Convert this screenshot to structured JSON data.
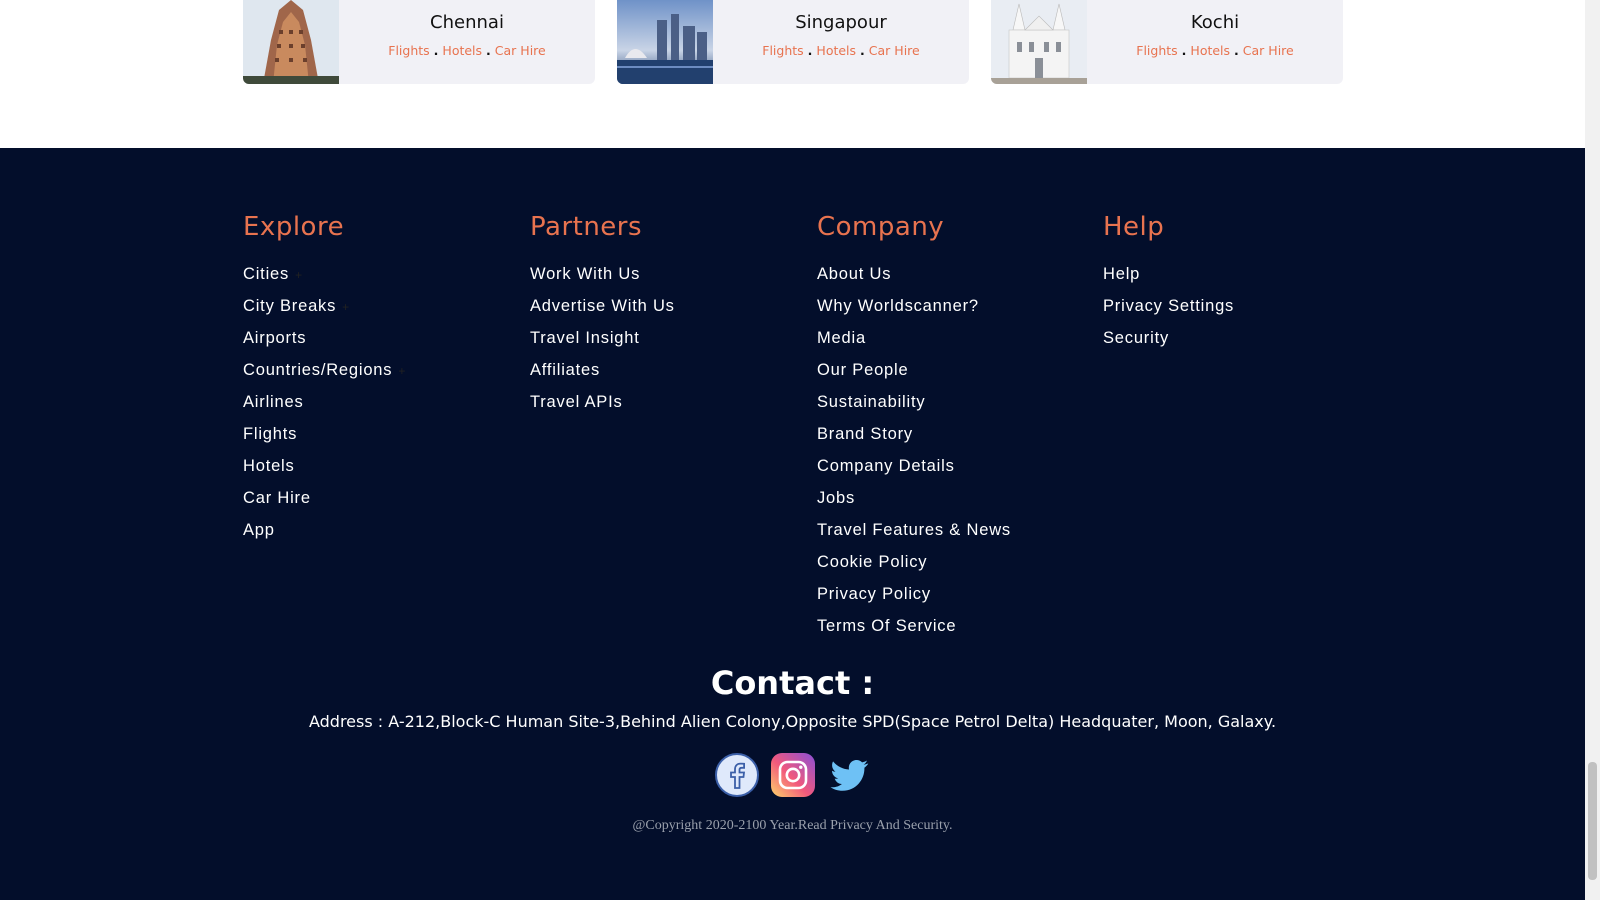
{
  "cards": [
    {
      "city": "Chennai",
      "links": [
        "Flights",
        "Hotels",
        "Car Hire"
      ]
    },
    {
      "city": "Singapour",
      "links": [
        "Flights",
        "Hotels",
        "Car Hire"
      ]
    },
    {
      "city": "Kochi",
      "links": [
        "Flights",
        "Hotels",
        "Car Hire"
      ]
    }
  ],
  "footer": {
    "explore": {
      "title": "Explore",
      "items": [
        "Cities",
        "City Breaks",
        "Airports",
        "Countries/Regions",
        "Airlines",
        "Flights",
        "Hotels",
        "Car Hire",
        "App"
      ]
    },
    "partners": {
      "title": "Partners",
      "items": [
        "Work With Us",
        "Advertise With Us",
        "Travel Insight",
        "Affiliates",
        "Travel APIs"
      ]
    },
    "company": {
      "title": "Company",
      "items": [
        "About Us",
        "Why Worldscanner?",
        "Media",
        "Our People",
        "Sustainability",
        "Brand Story",
        "Company Details",
        "Jobs",
        "Travel Features & News",
        "Cookie Policy",
        "Privacy Policy",
        "Terms Of Service"
      ]
    },
    "help": {
      "title": "Help",
      "items": [
        "Help",
        "Privacy Settings",
        "Security"
      ]
    },
    "contact_title": "Contact :",
    "address": "Address : A-212,Block-C Human Site-3,Behind Alien Colony,Opposite SPD(Space Petrol Delta) Headquater, Moon, Galaxy.",
    "social": [
      "facebook-icon",
      "instagram-icon",
      "twitter-icon"
    ],
    "copyright": "@Copyright 2020-2100 Year.Read Privacy And Security."
  },
  "colors": {
    "footer_bg": "#030e2b",
    "accent": "#e8734f",
    "card_bg": "#f1f1f6"
  }
}
